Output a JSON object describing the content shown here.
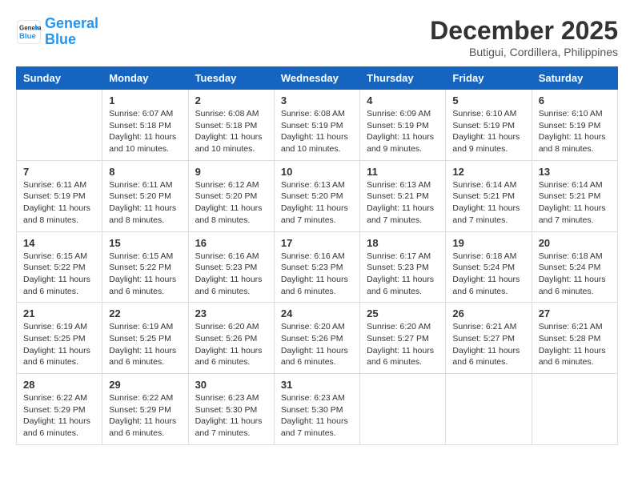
{
  "header": {
    "logo_line1": "General",
    "logo_line2": "Blue",
    "month": "December 2025",
    "location": "Butigui, Cordillera, Philippines"
  },
  "days_of_week": [
    "Sunday",
    "Monday",
    "Tuesday",
    "Wednesday",
    "Thursday",
    "Friday",
    "Saturday"
  ],
  "weeks": [
    [
      {
        "day": "",
        "info": ""
      },
      {
        "day": "1",
        "info": "Sunrise: 6:07 AM\nSunset: 5:18 PM\nDaylight: 11 hours\nand 10 minutes."
      },
      {
        "day": "2",
        "info": "Sunrise: 6:08 AM\nSunset: 5:18 PM\nDaylight: 11 hours\nand 10 minutes."
      },
      {
        "day": "3",
        "info": "Sunrise: 6:08 AM\nSunset: 5:19 PM\nDaylight: 11 hours\nand 10 minutes."
      },
      {
        "day": "4",
        "info": "Sunrise: 6:09 AM\nSunset: 5:19 PM\nDaylight: 11 hours\nand 9 minutes."
      },
      {
        "day": "5",
        "info": "Sunrise: 6:10 AM\nSunset: 5:19 PM\nDaylight: 11 hours\nand 9 minutes."
      },
      {
        "day": "6",
        "info": "Sunrise: 6:10 AM\nSunset: 5:19 PM\nDaylight: 11 hours\nand 8 minutes."
      }
    ],
    [
      {
        "day": "7",
        "info": "Sunrise: 6:11 AM\nSunset: 5:19 PM\nDaylight: 11 hours\nand 8 minutes."
      },
      {
        "day": "8",
        "info": "Sunrise: 6:11 AM\nSunset: 5:20 PM\nDaylight: 11 hours\nand 8 minutes."
      },
      {
        "day": "9",
        "info": "Sunrise: 6:12 AM\nSunset: 5:20 PM\nDaylight: 11 hours\nand 8 minutes."
      },
      {
        "day": "10",
        "info": "Sunrise: 6:13 AM\nSunset: 5:20 PM\nDaylight: 11 hours\nand 7 minutes."
      },
      {
        "day": "11",
        "info": "Sunrise: 6:13 AM\nSunset: 5:21 PM\nDaylight: 11 hours\nand 7 minutes."
      },
      {
        "day": "12",
        "info": "Sunrise: 6:14 AM\nSunset: 5:21 PM\nDaylight: 11 hours\nand 7 minutes."
      },
      {
        "day": "13",
        "info": "Sunrise: 6:14 AM\nSunset: 5:21 PM\nDaylight: 11 hours\nand 7 minutes."
      }
    ],
    [
      {
        "day": "14",
        "info": "Sunrise: 6:15 AM\nSunset: 5:22 PM\nDaylight: 11 hours\nand 6 minutes."
      },
      {
        "day": "15",
        "info": "Sunrise: 6:15 AM\nSunset: 5:22 PM\nDaylight: 11 hours\nand 6 minutes."
      },
      {
        "day": "16",
        "info": "Sunrise: 6:16 AM\nSunset: 5:23 PM\nDaylight: 11 hours\nand 6 minutes."
      },
      {
        "day": "17",
        "info": "Sunrise: 6:16 AM\nSunset: 5:23 PM\nDaylight: 11 hours\nand 6 minutes."
      },
      {
        "day": "18",
        "info": "Sunrise: 6:17 AM\nSunset: 5:23 PM\nDaylight: 11 hours\nand 6 minutes."
      },
      {
        "day": "19",
        "info": "Sunrise: 6:18 AM\nSunset: 5:24 PM\nDaylight: 11 hours\nand 6 minutes."
      },
      {
        "day": "20",
        "info": "Sunrise: 6:18 AM\nSunset: 5:24 PM\nDaylight: 11 hours\nand 6 minutes."
      }
    ],
    [
      {
        "day": "21",
        "info": "Sunrise: 6:19 AM\nSunset: 5:25 PM\nDaylight: 11 hours\nand 6 minutes."
      },
      {
        "day": "22",
        "info": "Sunrise: 6:19 AM\nSunset: 5:25 PM\nDaylight: 11 hours\nand 6 minutes."
      },
      {
        "day": "23",
        "info": "Sunrise: 6:20 AM\nSunset: 5:26 PM\nDaylight: 11 hours\nand 6 minutes."
      },
      {
        "day": "24",
        "info": "Sunrise: 6:20 AM\nSunset: 5:26 PM\nDaylight: 11 hours\nand 6 minutes."
      },
      {
        "day": "25",
        "info": "Sunrise: 6:20 AM\nSunset: 5:27 PM\nDaylight: 11 hours\nand 6 minutes."
      },
      {
        "day": "26",
        "info": "Sunrise: 6:21 AM\nSunset: 5:27 PM\nDaylight: 11 hours\nand 6 minutes."
      },
      {
        "day": "27",
        "info": "Sunrise: 6:21 AM\nSunset: 5:28 PM\nDaylight: 11 hours\nand 6 minutes."
      }
    ],
    [
      {
        "day": "28",
        "info": "Sunrise: 6:22 AM\nSunset: 5:29 PM\nDaylight: 11 hours\nand 6 minutes."
      },
      {
        "day": "29",
        "info": "Sunrise: 6:22 AM\nSunset: 5:29 PM\nDaylight: 11 hours\nand 6 minutes."
      },
      {
        "day": "30",
        "info": "Sunrise: 6:23 AM\nSunset: 5:30 PM\nDaylight: 11 hours\nand 7 minutes."
      },
      {
        "day": "31",
        "info": "Sunrise: 6:23 AM\nSunset: 5:30 PM\nDaylight: 11 hours\nand 7 minutes."
      },
      {
        "day": "",
        "info": ""
      },
      {
        "day": "",
        "info": ""
      },
      {
        "day": "",
        "info": ""
      }
    ]
  ]
}
